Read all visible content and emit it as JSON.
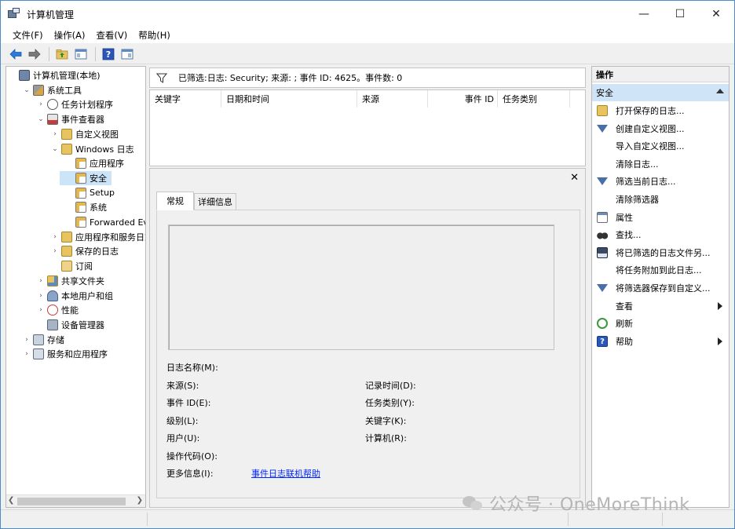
{
  "window": {
    "title": "计算机管理",
    "minimize": "—",
    "maximize": "☐",
    "close": "✕"
  },
  "menu": [
    "文件(F)",
    "操作(A)",
    "查看(V)",
    "帮助(H)"
  ],
  "tree": {
    "items": [
      {
        "label": "计算机管理(本地)",
        "level": 0,
        "expander": "",
        "icon": "computer-management-icon",
        "selected": false
      },
      {
        "label": "系统工具",
        "level": 1,
        "expander": "⌄",
        "icon": "system-tools-icon",
        "selected": false
      },
      {
        "label": "任务计划程序",
        "level": 2,
        "expander": "›",
        "icon": "clock-icon",
        "selected": false
      },
      {
        "label": "事件查看器",
        "level": 2,
        "expander": "⌄",
        "icon": "event-viewer-icon",
        "selected": false
      },
      {
        "label": "自定义视图",
        "level": 3,
        "expander": "›",
        "icon": "folder-icon",
        "selected": false
      },
      {
        "label": "Windows 日志",
        "level": 3,
        "expander": "⌄",
        "icon": "folder-icon",
        "selected": false
      },
      {
        "label": "应用程序",
        "level": 4,
        "expander": "",
        "icon": "log-icon",
        "selected": false
      },
      {
        "label": "安全",
        "level": 4,
        "expander": "",
        "icon": "log-icon",
        "selected": true
      },
      {
        "label": "Setup",
        "level": 4,
        "expander": "",
        "icon": "log-icon",
        "selected": false
      },
      {
        "label": "系统",
        "level": 4,
        "expander": "",
        "icon": "log-icon",
        "selected": false
      },
      {
        "label": "Forwarded Eve",
        "level": 4,
        "expander": "",
        "icon": "log-icon",
        "selected": false
      },
      {
        "label": "应用程序和服务日志",
        "level": 3,
        "expander": "›",
        "icon": "folder-icon",
        "selected": false
      },
      {
        "label": "保存的日志",
        "level": 3,
        "expander": "›",
        "icon": "folder-icon",
        "selected": false
      },
      {
        "label": "订阅",
        "level": 3,
        "expander": "",
        "icon": "subscription-icon",
        "selected": false
      },
      {
        "label": "共享文件夹",
        "level": 2,
        "expander": "›",
        "icon": "shared-folder-icon",
        "selected": false
      },
      {
        "label": "本地用户和组",
        "level": 2,
        "expander": "›",
        "icon": "users-icon",
        "selected": false
      },
      {
        "label": "性能",
        "level": 2,
        "expander": "›",
        "icon": "performance-icon",
        "selected": false
      },
      {
        "label": "设备管理器",
        "level": 2,
        "expander": "",
        "icon": "device-manager-icon",
        "selected": false
      },
      {
        "label": "存储",
        "level": 1,
        "expander": "›",
        "icon": "storage-icon",
        "selected": false
      },
      {
        "label": "服务和应用程序",
        "level": 1,
        "expander": "›",
        "icon": "services-icon",
        "selected": false
      }
    ]
  },
  "filter": {
    "text": "已筛选:日志: Security; 来源: ; 事件 ID: 4625。事件数: 0"
  },
  "columns": [
    "关键字",
    "日期和时间",
    "来源",
    "事件 ID",
    "任务类别"
  ],
  "detail": {
    "close": "✕",
    "tabs": [
      "常规",
      "详细信息"
    ],
    "fields": {
      "log_name": "日志名称(M):",
      "source": "来源(S):",
      "logged": "记录时间(D):",
      "event_id": "事件 ID(E):",
      "task_category": "任务类别(Y):",
      "level": "级别(L):",
      "keywords": "关键字(K):",
      "user": "用户(U):",
      "computer": "计算机(R):",
      "opcode": "操作代码(O):",
      "more_info": "更多信息(I):",
      "help_link": "事件日志联机帮助"
    }
  },
  "actions": {
    "header": "操作",
    "section": "安全",
    "items": [
      {
        "label": "打开保存的日志...",
        "icon": "open-folder-icon",
        "submenu": false
      },
      {
        "label": "创建自定义视图...",
        "icon": "filter-icon",
        "submenu": false
      },
      {
        "label": "导入自定义视图...",
        "icon": "",
        "submenu": false
      },
      {
        "label": "清除日志...",
        "icon": "",
        "submenu": false
      },
      {
        "label": "筛选当前日志...",
        "icon": "filter-icon",
        "submenu": false
      },
      {
        "label": "清除筛选器",
        "icon": "",
        "submenu": false
      },
      {
        "label": "属性",
        "icon": "properties-icon",
        "submenu": false
      },
      {
        "label": "查找...",
        "icon": "binoculars-icon",
        "submenu": false
      },
      {
        "label": "将已筛选的日志文件另...",
        "icon": "save-icon",
        "submenu": false
      },
      {
        "label": "将任务附加到此日志...",
        "icon": "",
        "submenu": false
      },
      {
        "label": "将筛选器保存到自定义...",
        "icon": "save-filter-icon",
        "submenu": false
      },
      {
        "label": "查看",
        "icon": "",
        "submenu": true
      },
      {
        "label": "刷新",
        "icon": "refresh-icon",
        "submenu": false
      },
      {
        "label": "帮助",
        "icon": "help-icon",
        "submenu": true
      }
    ]
  },
  "watermark": "公众号 · OneMoreThink"
}
